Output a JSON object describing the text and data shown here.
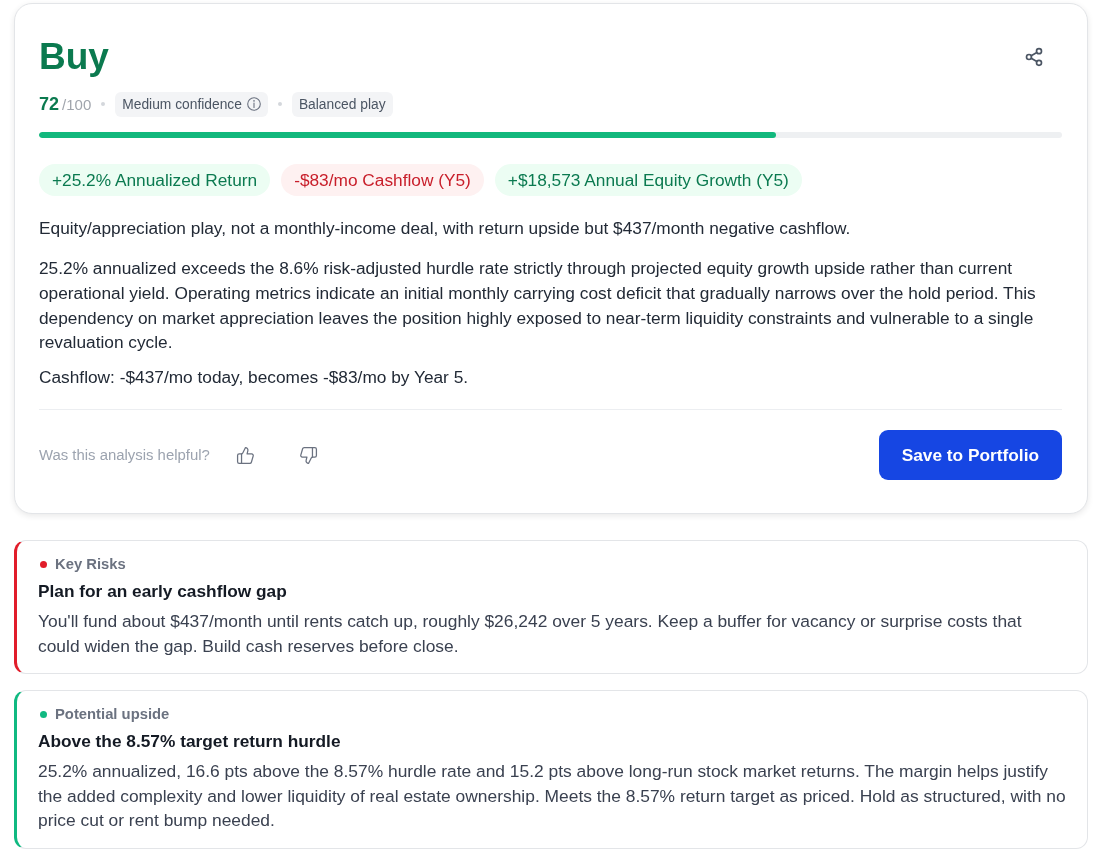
{
  "verdict": {
    "title": "Buy",
    "score": "72",
    "score_max": "/100",
    "score_bar": {
      "level": 0.72
    },
    "tags": [
      {
        "label": "Medium confidence",
        "info": true
      },
      {
        "label": "Balanced play",
        "info": false
      }
    ]
  },
  "metrics": [
    {
      "label": "+25.2% Annualized Return",
      "kind": "positive"
    },
    {
      "label": "-$83/mo Cashflow (Y5)",
      "kind": "negative"
    },
    {
      "label": "+$18,573 Annual Equity Growth (Y5)",
      "kind": "positive"
    }
  ],
  "summary": "Equity/appreciation play, not a monthly-income deal, with return upside but $437/month negative cashflow.",
  "analysis": "25.2% annualized exceeds the 8.6% risk-adjusted hurdle rate strictly through projected equity growth upside rather than current operational yield. Operating metrics indicate an initial monthly carrying cost deficit that gradually narrows over the hold period. This dependency on market appreciation leaves the position highly exposed to near-term liquidity constraints and vulnerable to a single revaluation cycle.",
  "cashflow_note": "Cashflow: -$437/mo today, becomes -$83/mo by Year 5.",
  "feedback": {
    "prompt": "Was this analysis helpful?"
  },
  "save_button": "Save to Portfolio",
  "insights": [
    {
      "category": "Key Risks",
      "color": "#e11d2a",
      "title": "Plan for an early cashflow gap",
      "body": "You'll fund about $437/month until rents catch up, roughly $26,242 over 5 years. Keep a buffer for vacancy or surprise costs that could widen the gap. Build cash reserves before close."
    },
    {
      "category": "Potential upside",
      "color": "#10b981",
      "title": "Above the 8.57% target return hurdle",
      "body": "25.2% annualized, 16.6 pts above the 8.57% hurdle rate and 15.2 pts above long-run stock market returns. The margin helps justify the added complexity and lower liquidity of real estate ownership. Meets the 8.57% return target as priced. Hold as structured, with no price cut or rent bump needed."
    }
  ]
}
